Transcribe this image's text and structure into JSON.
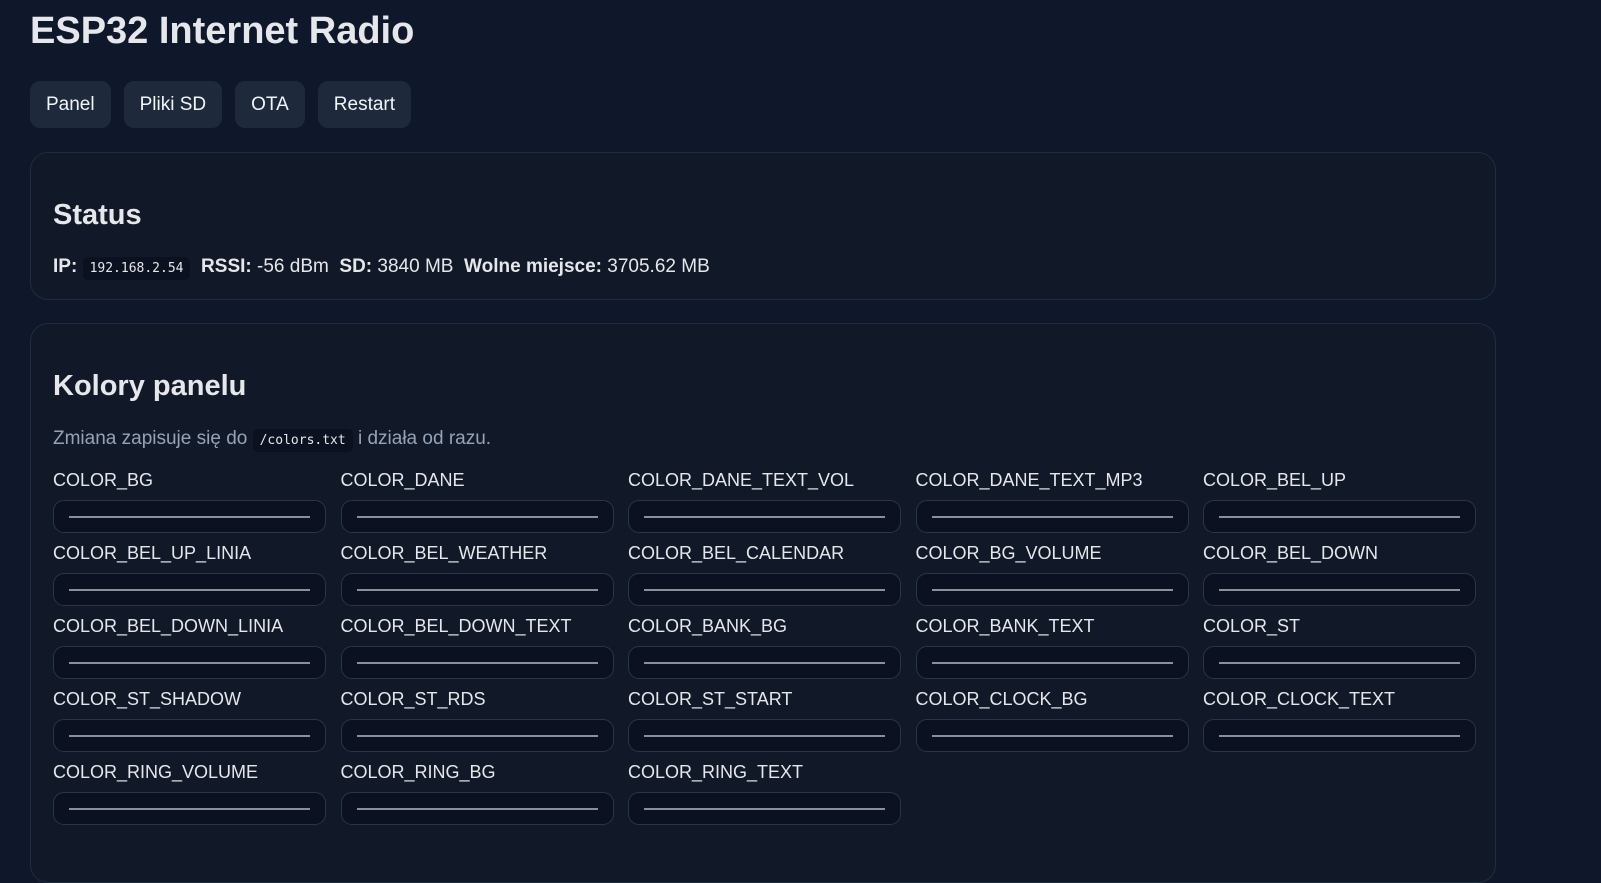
{
  "title": "ESP32 Internet Radio",
  "nav": [
    "Panel",
    "Pliki SD",
    "OTA",
    "Restart"
  ],
  "status": {
    "heading": "Status",
    "ip_label": "IP:",
    "ip": "192.168.2.54",
    "rssi_label": "RSSI:",
    "rssi": "-56 dBm",
    "sd_label": "SD:",
    "sd": "3840 MB",
    "free_label": "Wolne miejsce:",
    "free": "3705.62 MB"
  },
  "colors": {
    "heading": "Kolory panelu",
    "note_before": "Zmiana zapisuje się do",
    "note_file": "/colors.txt",
    "note_after": "i działa od razu.",
    "fields": [
      "COLOR_BG",
      "COLOR_DANE",
      "COLOR_DANE_TEXT_VOL",
      "COLOR_DANE_TEXT_MP3",
      "COLOR_BEL_UP",
      "COLOR_BEL_UP_LINIA",
      "COLOR_BEL_WEATHER",
      "COLOR_BEL_CALENDAR",
      "COLOR_BG_VOLUME",
      "COLOR_BEL_DOWN",
      "COLOR_BEL_DOWN_LINIA",
      "COLOR_BEL_DOWN_TEXT",
      "COLOR_BANK_BG",
      "COLOR_BANK_TEXT",
      "COLOR_ST",
      "COLOR_ST_SHADOW",
      "COLOR_ST_RDS",
      "COLOR_ST_START",
      "COLOR_CLOCK_BG",
      "COLOR_CLOCK_TEXT",
      "COLOR_RING_VOLUME",
      "COLOR_RING_BG",
      "COLOR_RING_TEXT"
    ]
  }
}
